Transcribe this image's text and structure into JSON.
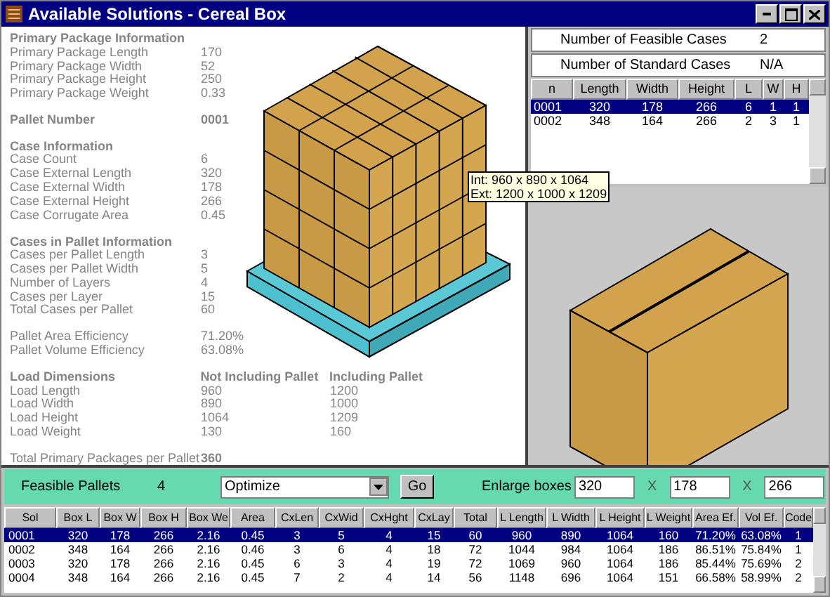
{
  "window": {
    "title": "Available Solutions - Cereal Box"
  },
  "info_sections": [
    {
      "heading": "Primary Package Information",
      "rows": [
        {
          "label": "Primary Package Length",
          "value": "170"
        },
        {
          "label": "Primary Package Width",
          "value": "52"
        },
        {
          "label": "Primary Package Height",
          "value": "250"
        },
        {
          "label": "Primary Package Weight",
          "value": "0.33"
        }
      ]
    },
    {
      "heading_label": "Pallet Number",
      "heading_value": "0001"
    },
    {
      "heading": "Case Information",
      "rows": [
        {
          "label": "Case Count",
          "value": "6"
        },
        {
          "label": "Case External Length",
          "value": "320"
        },
        {
          "label": "Case External Width",
          "value": "178"
        },
        {
          "label": "Case External Height",
          "value": "266"
        },
        {
          "label": "Case Corrugate Area",
          "value": "0.45"
        }
      ]
    },
    {
      "heading": "Cases in Pallet Information",
      "rows": [
        {
          "label": "Cases per Pallet Length",
          "value": "3"
        },
        {
          "label": "Cases per Pallet Width",
          "value": "5"
        },
        {
          "label": "Number of Layers",
          "value": "4"
        },
        {
          "label": "Cases per Layer",
          "value": "15"
        },
        {
          "label": "Total Cases per Pallet",
          "value": "60"
        }
      ]
    },
    {
      "rows": [
        {
          "label": "Pallet Area Efficiency",
          "value": "71.20%"
        },
        {
          "label": "Pallet Volume Efficiency",
          "value": "63.08%"
        }
      ]
    }
  ],
  "load_dimensions": {
    "heading": "Load Dimensions",
    "column_1": "Not Including Pallet",
    "column_2": "Including Pallet",
    "rows": [
      {
        "label": "Load Length",
        "value_1": "960",
        "value_2": "1200"
      },
      {
        "label": "Load Width",
        "value_1": "890",
        "value_2": "1000"
      },
      {
        "label": "Load Height",
        "value_1": "1064",
        "value_2": "1209"
      },
      {
        "label": "Load Weight",
        "value_1": "130",
        "value_2": "160"
      }
    ]
  },
  "total_packages": {
    "label": "Total Primary Packages per Pallet",
    "value": "360"
  },
  "tooltip": [
    "Int: 960 x 890 x 1064",
    "Ext: 1200 x 1000 x 1209"
  ],
  "case_summary": [
    {
      "label": "Number of Feasible Cases",
      "value": "2"
    },
    {
      "label": "Number of Standard Cases",
      "value": "N/A"
    }
  ],
  "case_table": {
    "columns": [
      "n",
      "Length",
      "Width",
      "Height",
      "L",
      "W",
      "H"
    ],
    "rows": [
      {
        "selected": true,
        "cells": [
          "0001",
          "320",
          "178",
          "266",
          "6",
          "1",
          "1"
        ]
      },
      {
        "selected": false,
        "cells": [
          "0002",
          "348",
          "164",
          "266",
          "2",
          "3",
          "1"
        ]
      }
    ]
  },
  "controls": {
    "feasible_label": "Feasible Pallets",
    "feasible_count": "4",
    "mode": "Optimize",
    "go": "Go",
    "enlarge_label": "Enlarge boxes",
    "sizes": [
      "320",
      "178",
      "266"
    ],
    "separators": [
      "X",
      "X"
    ]
  },
  "pallet_table": {
    "columns": [
      "Sol",
      "Box L",
      "Box W",
      "Box H",
      "Box We",
      "Area",
      "CxLen",
      "CxWid",
      "CxHght",
      "CxLay",
      "Total",
      "L Length",
      "L Width",
      "L Height",
      "L Weight",
      "Area Ef.",
      "Vol Ef.",
      "Code"
    ],
    "rows": [
      {
        "selected": true,
        "cells": [
          "0001",
          "320",
          "178",
          "266",
          "2.16",
          "0.45",
          "3",
          "5",
          "4",
          "15",
          "60",
          "960",
          "890",
          "1064",
          "160",
          "71.20%",
          "63.08%",
          "1"
        ]
      },
      {
        "selected": false,
        "cells": [
          "0002",
          "348",
          "164",
          "266",
          "2.16",
          "0.46",
          "3",
          "6",
          "4",
          "18",
          "72",
          "1044",
          "984",
          "1064",
          "186",
          "86.51%",
          "75.84%",
          "1"
        ]
      },
      {
        "selected": false,
        "cells": [
          "0003",
          "320",
          "178",
          "266",
          "2.16",
          "0.45",
          "6",
          "3",
          "4",
          "19",
          "72",
          "1069",
          "960",
          "1064",
          "186",
          "85.44%",
          "75.69%",
          "2"
        ]
      },
      {
        "selected": false,
        "cells": [
          "0004",
          "348",
          "164",
          "266",
          "2.16",
          "0.45",
          "7",
          "2",
          "4",
          "14",
          "56",
          "1148",
          "696",
          "1064",
          "151",
          "66.58%",
          "58.99%",
          "2"
        ]
      }
    ]
  }
}
